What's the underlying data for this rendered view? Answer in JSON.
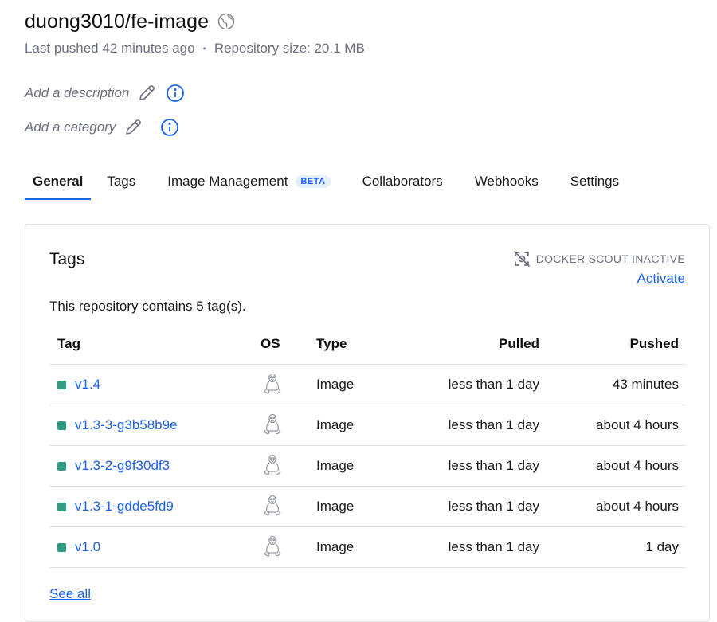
{
  "repo": {
    "title": "duong3010/fe-image",
    "last_pushed": "Last pushed 42 minutes ago",
    "separator": "•",
    "size": "Repository size: 20.1 MB"
  },
  "edit": {
    "description_placeholder": "Add a description",
    "category_placeholder": "Add a category"
  },
  "tabs": [
    {
      "label": "General",
      "active": true
    },
    {
      "label": "Tags"
    },
    {
      "label": "Image Management",
      "badge": "BETA"
    },
    {
      "label": "Collaborators"
    },
    {
      "label": "Webhooks"
    },
    {
      "label": "Settings"
    }
  ],
  "tags_card": {
    "title": "Tags",
    "scout_status": "DOCKER SCOUT INACTIVE",
    "activate_label": "Activate",
    "count_text": "This repository contains 5 tag(s).",
    "columns": {
      "tag": "Tag",
      "os": "OS",
      "type": "Type",
      "pulled": "Pulled",
      "pushed": "Pushed"
    },
    "rows": [
      {
        "tag": "v1.4",
        "os_icon": "linux-icon",
        "type": "Image",
        "pulled": "less than 1 day",
        "pushed": "43 minutes"
      },
      {
        "tag": "v1.3-3-g3b58b9e",
        "os_icon": "linux-icon",
        "type": "Image",
        "pulled": "less than 1 day",
        "pushed": "about 4 hours"
      },
      {
        "tag": "v1.3-2-g9f30df3",
        "os_icon": "linux-icon",
        "type": "Image",
        "pulled": "less than 1 day",
        "pushed": "about 4 hours"
      },
      {
        "tag": "v1.3-1-gdde5fd9",
        "os_icon": "linux-icon",
        "type": "Image",
        "pulled": "less than 1 day",
        "pushed": "about 4 hours"
      },
      {
        "tag": "v1.0",
        "os_icon": "linux-icon",
        "type": "Image",
        "pulled": "less than 1 day",
        "pushed": "1 day"
      }
    ],
    "see_all_label": "See all"
  },
  "colors": {
    "accent": "#1d63ed",
    "status_green": "#2e9d83",
    "muted_text": "#6c7080"
  }
}
